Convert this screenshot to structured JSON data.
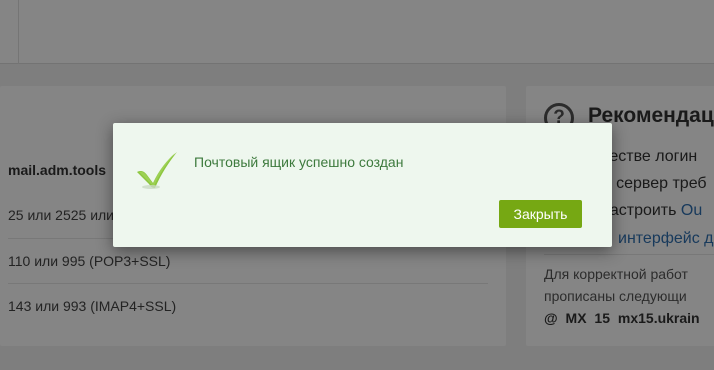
{
  "settings": {
    "server_label": "mail.adm.tools",
    "smtp_ports": "25 или 2525 или",
    "pop3_ports": "110 или 995 (POP3+SSL)",
    "imap_ports": "143 или 993 (IMAP4+SSL)"
  },
  "recommendations": {
    "title": "Рекомендаци",
    "line1": "честве логин",
    "line2": "Р сервер треб",
    "line3_prefix": "настроить ",
    "line3_link": "Ou",
    "line4": "интерфейс д",
    "note_line1": "Для корректной работ",
    "note_line2": "прописаны следующи",
    "mx_record": "@  MX  15  mx15.ukrain"
  },
  "modal": {
    "icon": "checkmark-icon",
    "message": "Почтовый ящик успешно создан",
    "close_label": "Закрыть"
  },
  "colors": {
    "overlay": "rgba(0,0,0,0.48)",
    "modal_bg": "#eef7ee",
    "message_text": "#3d7a3d",
    "button_bg": "#76a813",
    "check_green": "#8cc63f"
  }
}
